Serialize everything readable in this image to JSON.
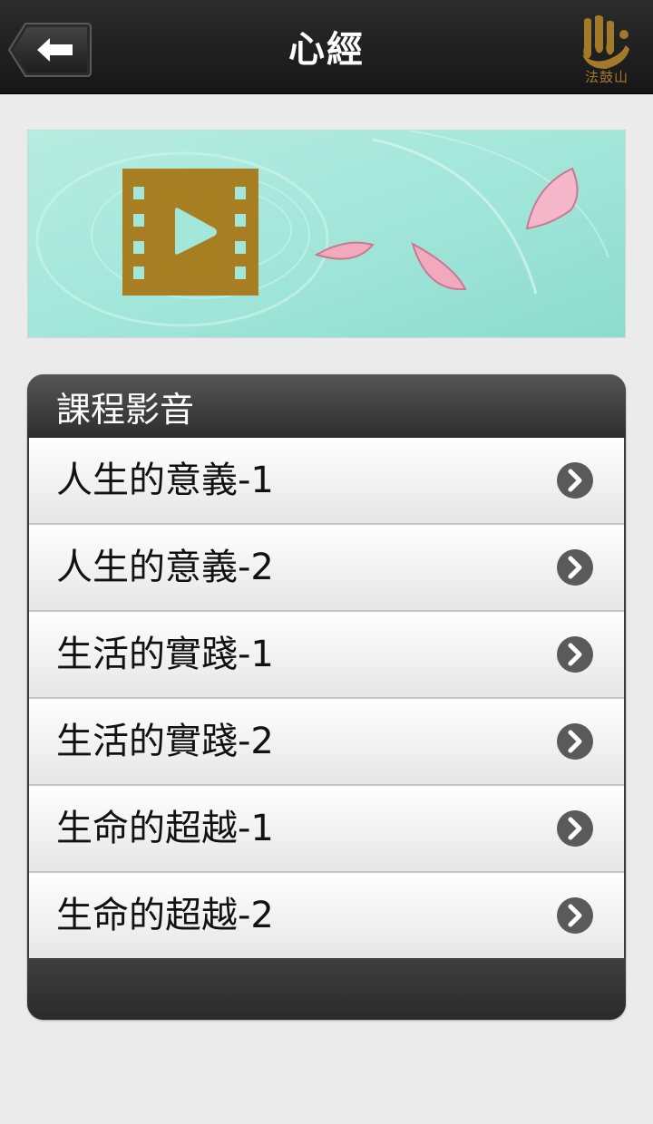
{
  "header": {
    "title": "心經",
    "logo_text": "法鼓山",
    "back_icon": "back-arrow-icon"
  },
  "banner": {
    "icon": "video-play-icon",
    "colors": {
      "background": "#a3e6da",
      "icon": "#a87e23",
      "petal": "#f2a9be"
    }
  },
  "section": {
    "title": "課程影音",
    "items": [
      {
        "label": "人生的意義-1"
      },
      {
        "label": "人生的意義-2"
      },
      {
        "label": "生活的實踐-1"
      },
      {
        "label": "生活的實踐-2"
      },
      {
        "label": "生命的超越-1"
      },
      {
        "label": "生命的超越-2"
      }
    ],
    "item_icon": "chevron-right-icon"
  },
  "colors": {
    "topbar": "#1e1e1e",
    "page": "#ebebeb",
    "brand_gold": "#a27a2a"
  }
}
